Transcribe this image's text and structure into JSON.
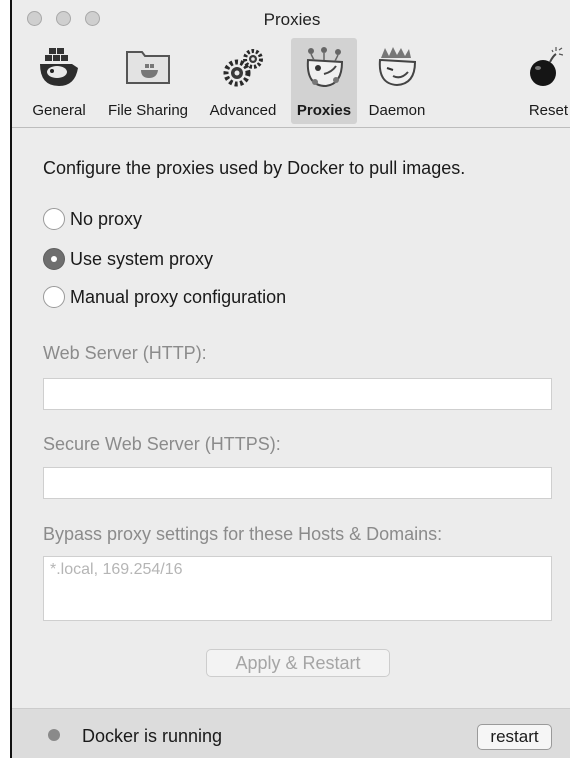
{
  "window": {
    "title": "Proxies"
  },
  "toolbar": {
    "items": [
      {
        "label": "General",
        "icon": "docker-whale-icon"
      },
      {
        "label": "File Sharing",
        "icon": "folder-icon"
      },
      {
        "label": "Advanced",
        "icon": "gears-icon"
      },
      {
        "label": "Proxies",
        "icon": "proxy-whale-icon",
        "active": true
      },
      {
        "label": "Daemon",
        "icon": "daemon-whale-icon"
      },
      {
        "label": "Reset",
        "icon": "bomb-icon"
      }
    ]
  },
  "proxies": {
    "intro": "Configure the proxies used by Docker to pull images.",
    "options": [
      {
        "label": "No proxy",
        "checked": false
      },
      {
        "label": "Use system proxy",
        "checked": true
      },
      {
        "label": "Manual proxy configuration",
        "checked": false
      }
    ],
    "http_label": "Web Server (HTTP):",
    "http_value": "",
    "https_label": "Secure Web Server (HTTPS):",
    "https_value": "",
    "bypass_label": "Bypass proxy settings for these Hosts & Domains:",
    "bypass_value": "*.local, 169.254/16",
    "apply_label": "Apply & Restart"
  },
  "status": {
    "text": "Docker is running",
    "restart_label": "restart"
  },
  "colors": {
    "window_bg": "#ececec",
    "active_tab_bg": "#d2d2d2",
    "radio_checked": "#6e6e6e"
  }
}
